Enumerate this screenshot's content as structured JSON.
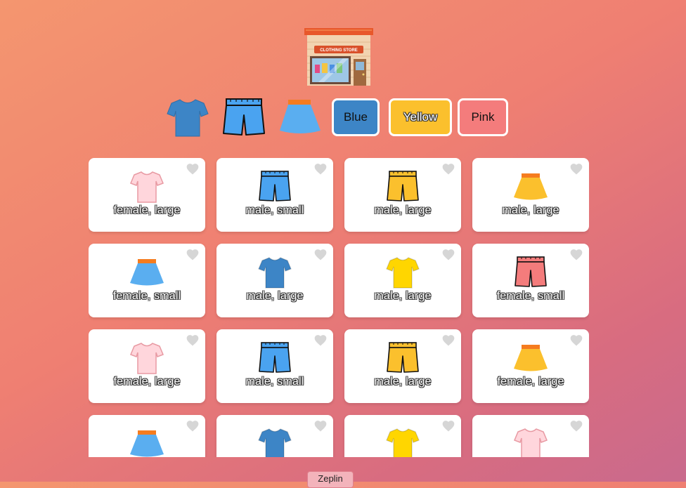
{
  "store": {
    "sign_text": "CLOTHING STORE",
    "icon": "clothing-store-icon"
  },
  "filters": {
    "types": [
      {
        "name": "shirt",
        "icon": "shirt-icon"
      },
      {
        "name": "shorts",
        "icon": "shorts-icon"
      },
      {
        "name": "skirt",
        "icon": "skirt-icon"
      }
    ],
    "colors": [
      {
        "label": "Blue",
        "color": "#3d85c6"
      },
      {
        "label": "Yellow",
        "color": "#fbc02d"
      },
      {
        "label": "Pink",
        "color": "#f47c7c"
      }
    ]
  },
  "palette": {
    "pink": "#ffd6dc",
    "pink_trim": "#e89aa3",
    "blue": "#4aa3f0",
    "blue_dark": "#3d85c6",
    "yellow": "#fbc02d",
    "yellow_bright": "#ffd600",
    "salmon": "#f47c7c",
    "orange": "#f57c1f",
    "heart": "#d6d6d6"
  },
  "products": [
    {
      "type": "shirt",
      "color": "pink",
      "label": "female, large"
    },
    {
      "type": "shorts",
      "color": "blue",
      "label": "male, small"
    },
    {
      "type": "shorts",
      "color": "yellow",
      "label": "male, large"
    },
    {
      "type": "skirt",
      "color": "yellow",
      "label": "male, large"
    },
    {
      "type": "skirt",
      "color": "blue",
      "label": "female, small"
    },
    {
      "type": "shirt",
      "color": "blue_dark",
      "label": "male, large"
    },
    {
      "type": "shirt",
      "color": "yellow_bright",
      "label": "male, large"
    },
    {
      "type": "shorts",
      "color": "salmon",
      "label": "female, small"
    },
    {
      "type": "shirt",
      "color": "pink",
      "label": "female, large"
    },
    {
      "type": "shorts",
      "color": "blue",
      "label": "male, small"
    },
    {
      "type": "shorts",
      "color": "yellow",
      "label": "male, large"
    },
    {
      "type": "skirt",
      "color": "yellow",
      "label": "female, large"
    },
    {
      "type": "skirt",
      "color": "blue",
      "label": ""
    },
    {
      "type": "shirt",
      "color": "blue_dark",
      "label": ""
    },
    {
      "type": "shirt",
      "color": "yellow_bright",
      "label": ""
    },
    {
      "type": "shirt",
      "color": "pink",
      "label": ""
    }
  ],
  "footer": {
    "zeplin_label": "Zeplin"
  }
}
